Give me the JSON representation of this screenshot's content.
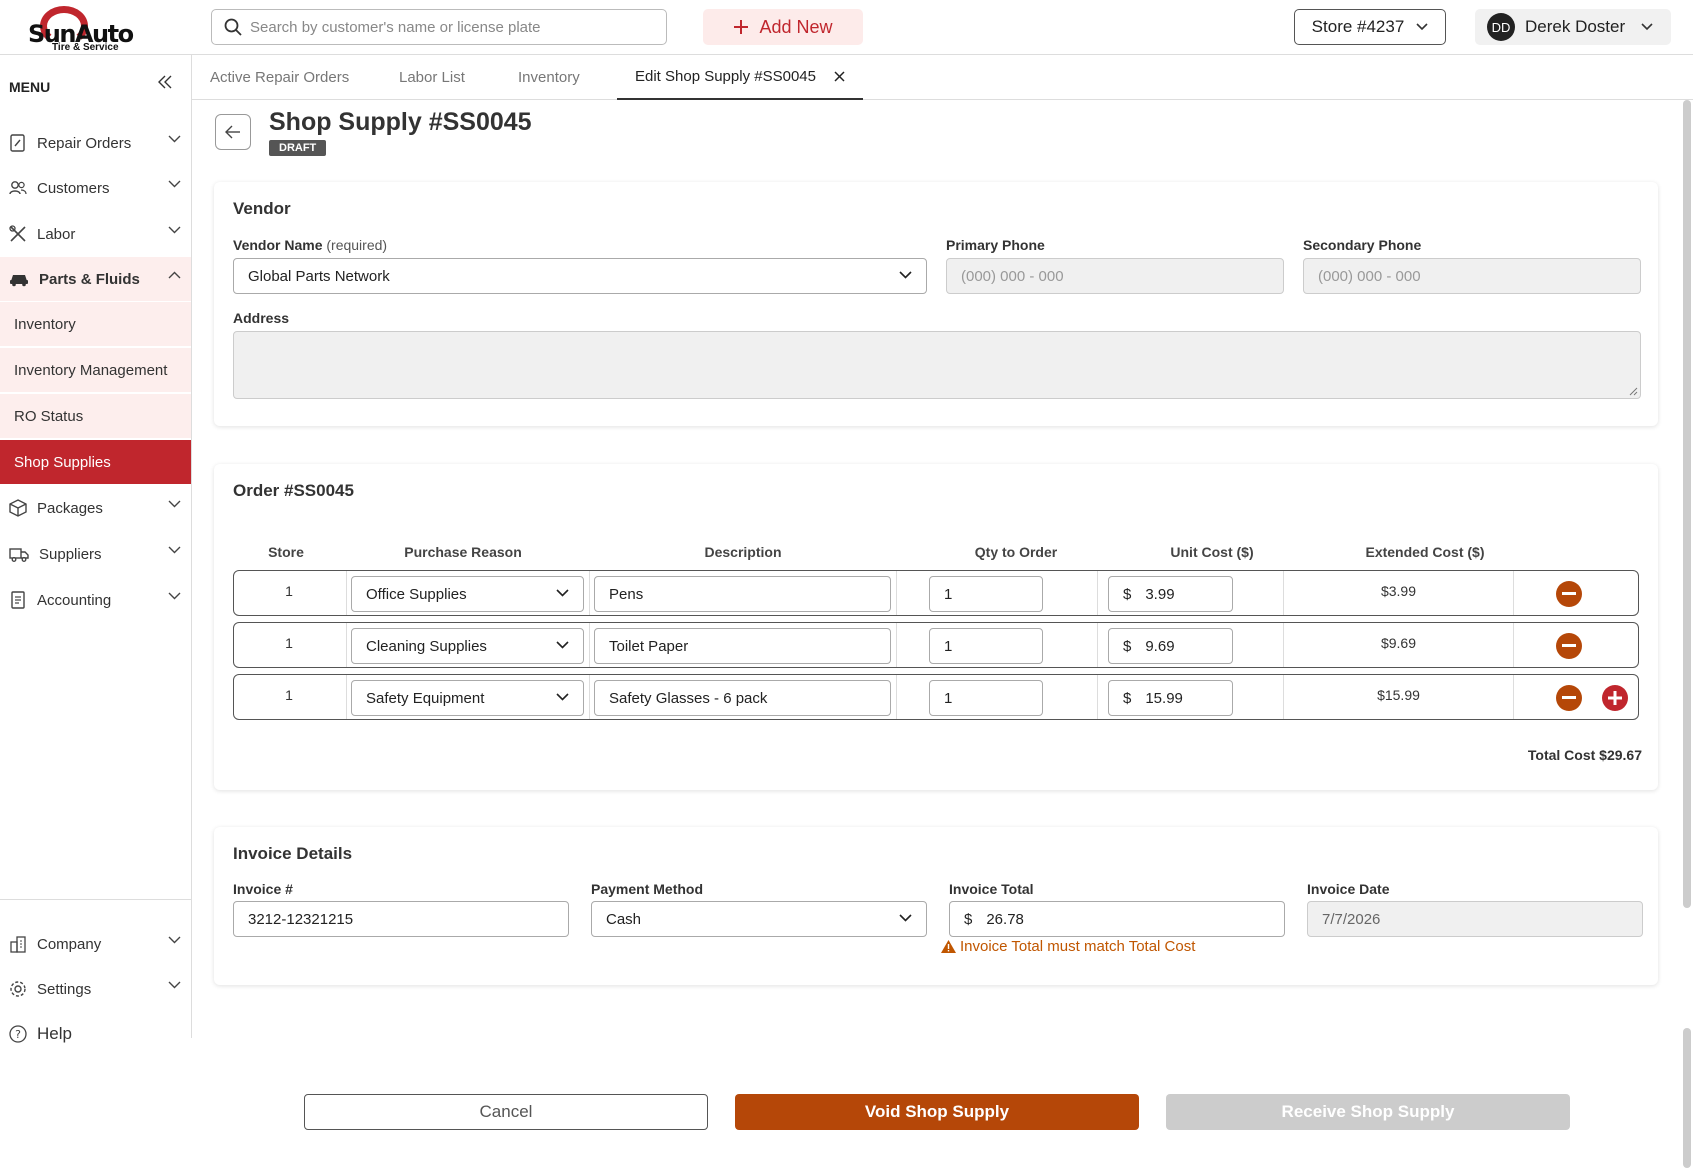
{
  "app": {
    "brand": "SunAuto",
    "brand_sub": "Tire & Service"
  },
  "header": {
    "search_placeholder": "Search by customer's name or license plate",
    "add_new": "Add New",
    "store": "Store #4237",
    "user_initials": "DD",
    "user_name": "Derek Doster"
  },
  "sidebar": {
    "menu_label": "MENU",
    "items": {
      "repair_orders": "Repair Orders",
      "customers": "Customers",
      "labor": "Labor",
      "parts_fluids": "Parts & Fluids",
      "inventory": "Inventory",
      "inventory_management": "Inventory Management",
      "ro_status": "RO Status",
      "shop_supplies": "Shop Supplies",
      "packages": "Packages",
      "suppliers": "Suppliers",
      "accounting": "Accounting",
      "company": "Company",
      "settings": "Settings",
      "help": "Help"
    }
  },
  "tabs": {
    "active_repair_orders": "Active Repair Orders",
    "labor_list": "Labor List",
    "inventory": "Inventory",
    "edit_shop_supply": "Edit Shop Supply #SS0045"
  },
  "page": {
    "title": "Shop Supply #SS0045",
    "status": "DRAFT"
  },
  "vendor": {
    "heading": "Vendor",
    "name_label": "Vendor Name",
    "name_required": "(required)",
    "name_value": "Global Parts Network",
    "primary_phone_label": "Primary Phone",
    "primary_phone_placeholder": "(000) 000 - 000",
    "secondary_phone_label": "Secondary Phone",
    "secondary_phone_placeholder": "(000) 000 - 000",
    "address_label": "Address"
  },
  "order": {
    "heading": "Order #SS0045",
    "columns": {
      "store": "Store",
      "purchase_reason": "Purchase Reason",
      "description": "Description",
      "qty": "Qty to Order",
      "unit_cost": "Unit Cost ($)",
      "extended_cost": "Extended Cost ($)"
    },
    "rows": [
      {
        "store": "1",
        "reason": "Office Supplies",
        "description": "Pens",
        "qty": "1",
        "unit_cost": "3.99",
        "extended": "$3.99"
      },
      {
        "store": "1",
        "reason": "Cleaning Supplies",
        "description": "Toilet Paper",
        "qty": "1",
        "unit_cost": "9.69",
        "extended": "$9.69"
      },
      {
        "store": "1",
        "reason": "Safety Equipment",
        "description": "Safety Glasses - 6 pack",
        "qty": "1",
        "unit_cost": "15.99",
        "extended": "$15.99"
      }
    ],
    "currency_symbol": "$",
    "total": "Total Cost $29.67"
  },
  "invoice": {
    "heading": "Invoice Details",
    "number_label": "Invoice #",
    "number_value": "3212-12321215",
    "payment_label": "Payment Method",
    "payment_value": "Cash",
    "total_label": "Invoice Total",
    "total_value": "26.78",
    "date_label": "Invoice Date",
    "date_value": "7/7/2026",
    "warning": "Invoice Total must match Total Cost"
  },
  "actions": {
    "cancel": "Cancel",
    "void": "Void Shop Supply",
    "receive": "Receive Shop Supply"
  },
  "colors": {
    "brand_red": "#c0262d",
    "action_orange": "#b54708",
    "sidebar_sub_bg": "#fdeeed"
  }
}
